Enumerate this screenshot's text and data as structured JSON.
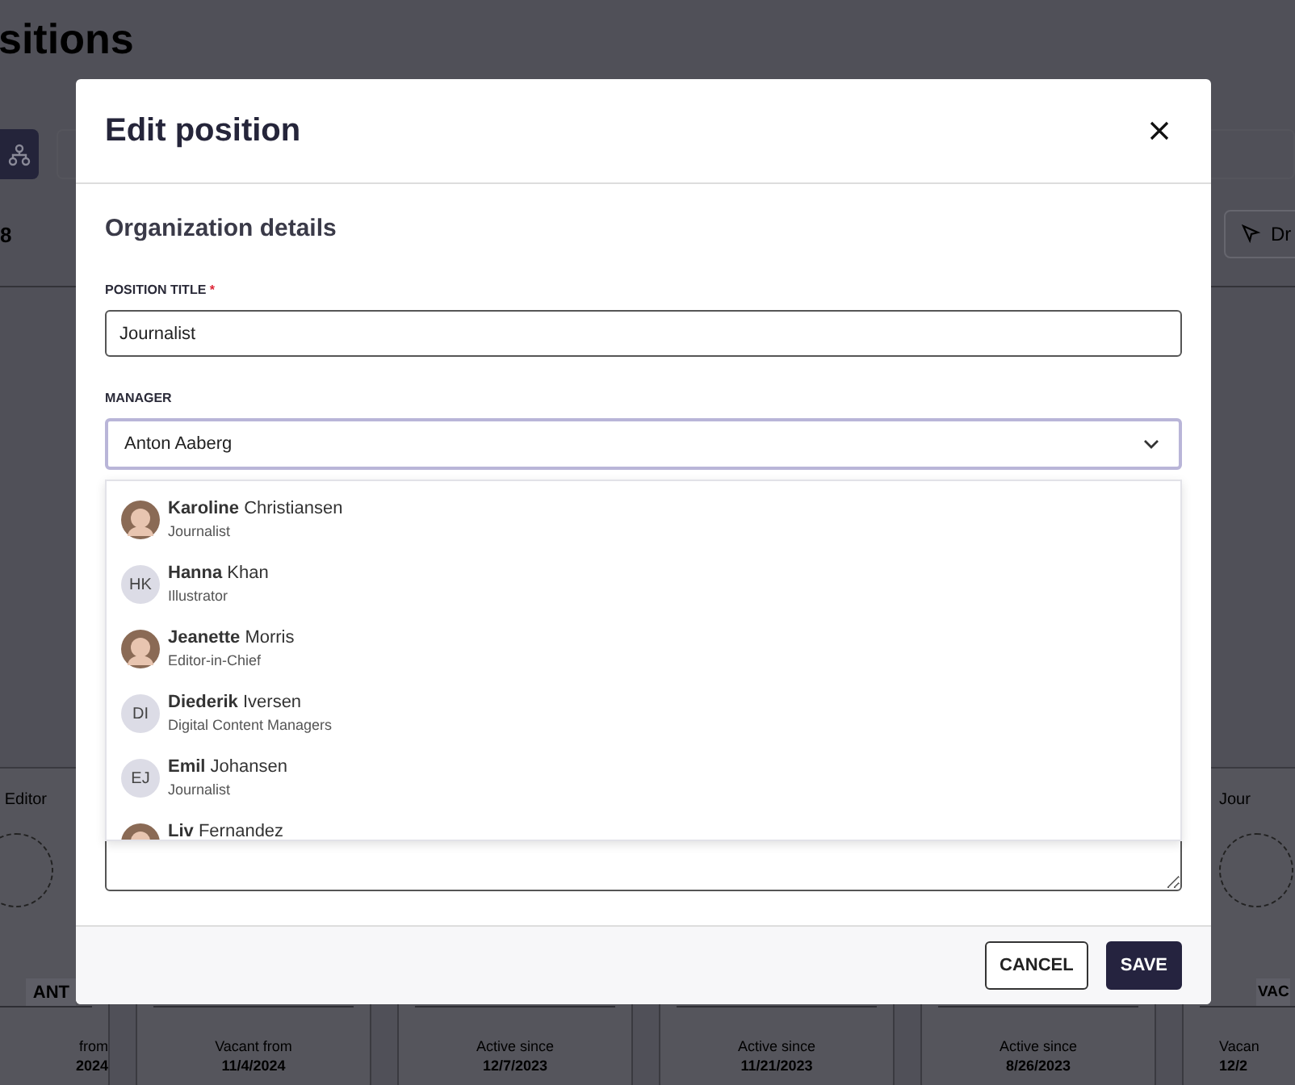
{
  "page": {
    "title": "sitions",
    "count": "8",
    "toolbar_button": "Dr"
  },
  "background_cards": [
    {
      "role": "Editor",
      "badge": "ANT",
      "status": "from",
      "date": "2024"
    },
    {
      "status": "Vacant from",
      "date": "11/4/2024"
    },
    {
      "status": "Active since",
      "date": "12/7/2023"
    },
    {
      "status": "Active since",
      "date": "11/21/2023"
    },
    {
      "status": "Active since",
      "date": "8/26/2023"
    },
    {
      "role": "Jour",
      "badge": "VAC",
      "status": "Vacan",
      "date": "12/2"
    }
  ],
  "dialog": {
    "title": "Edit position",
    "section": "Organization details",
    "position_title": {
      "label": "POSITION TITLE",
      "required_mark": "*",
      "value": "Journalist"
    },
    "manager": {
      "label": "MANAGER",
      "value": "Anton Aaberg",
      "expanded": true,
      "options": [
        {
          "name": "**Karoline** Christiansen",
          "role": "Journalist",
          "kind": "photo"
        },
        {
          "name": "**Hanna** Khan",
          "role": "Illustrator",
          "kind": "initials",
          "initials": "HK"
        },
        {
          "name": "**Jeanette** Morris",
          "role": "Editor-in-Chief",
          "kind": "photo"
        },
        {
          "name": "**Diederik** Iversen",
          "role": "Digital Content Managers",
          "kind": "initials",
          "initials": "DI"
        },
        {
          "name": "**Emil** Johansen",
          "role": "Journalist",
          "kind": "initials",
          "initials": "EJ"
        },
        {
          "name": "**Liv** Fernandez",
          "kind": "photo"
        }
      ]
    },
    "buttons": [
      {
        "label": "CANCEL",
        "kind": "secondary"
      },
      {
        "label": "SAVE",
        "kind": "primary"
      }
    ]
  }
}
